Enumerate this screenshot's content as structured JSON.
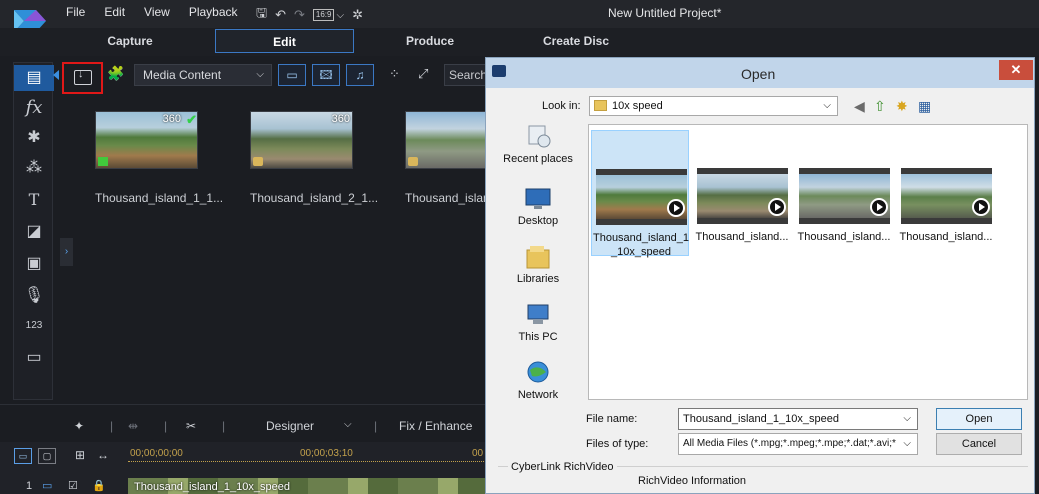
{
  "menu": {
    "items": [
      "File",
      "Edit",
      "View",
      "Playback"
    ]
  },
  "toolbar": {
    "ratio": "16:9",
    "ratio_chevron": "⌵"
  },
  "project": {
    "title": "New Untitled Project*"
  },
  "modes": {
    "capture": "Capture",
    "edit": "Edit",
    "produce": "Produce",
    "create_disc": "Create Disc"
  },
  "media": {
    "content_select": "Media Content",
    "search_placeholder": "Search",
    "clips": [
      {
        "label": "Thousand_island_1_1...",
        "badge": "360"
      },
      {
        "label": "Thousand_island_2_1...",
        "badge": "360"
      },
      {
        "label": "Thousand_islan",
        "badge": ""
      }
    ]
  },
  "lefttools": {
    "fx": "fx",
    "title": "T"
  },
  "bottom": {
    "designer": "Designer",
    "fix_enhance": "Fix / Enhance"
  },
  "timeline": {
    "time_start": "00;00;00;00",
    "time_mid": "00;00;03;10",
    "time_end": "00",
    "track_number": "1",
    "clip_title": "Thousand_island_1_10x_speed"
  },
  "dialog": {
    "title": "Open",
    "close": "✕",
    "look_in_label": "Look in:",
    "look_in_value": "10x speed",
    "places": [
      "Recent places",
      "Desktop",
      "Libraries",
      "This PC",
      "Network"
    ],
    "files": [
      {
        "name": "Thousand_island_1_10x_speed"
      },
      {
        "name": "Thousand_island..."
      },
      {
        "name": "Thousand_island..."
      },
      {
        "name": "Thousand_island..."
      }
    ],
    "file_name_label": "File name:",
    "file_name_value": "Thousand_island_1_10x_speed",
    "files_of_type_label": "Files of type:",
    "files_of_type_value": "All Media Files (*.mpg;*.mpeg;*.mpe;*.dat;*.avi;*",
    "open_button": "Open",
    "cancel_button": "Cancel",
    "group_label": "CyberLink RichVideo",
    "rich_info": "RichVideo Information"
  },
  "colors": {
    "accent": "#3b78c4",
    "highlight": "#e01818",
    "dialog_title": "#c1d5ea",
    "close": "#c94e3c"
  }
}
